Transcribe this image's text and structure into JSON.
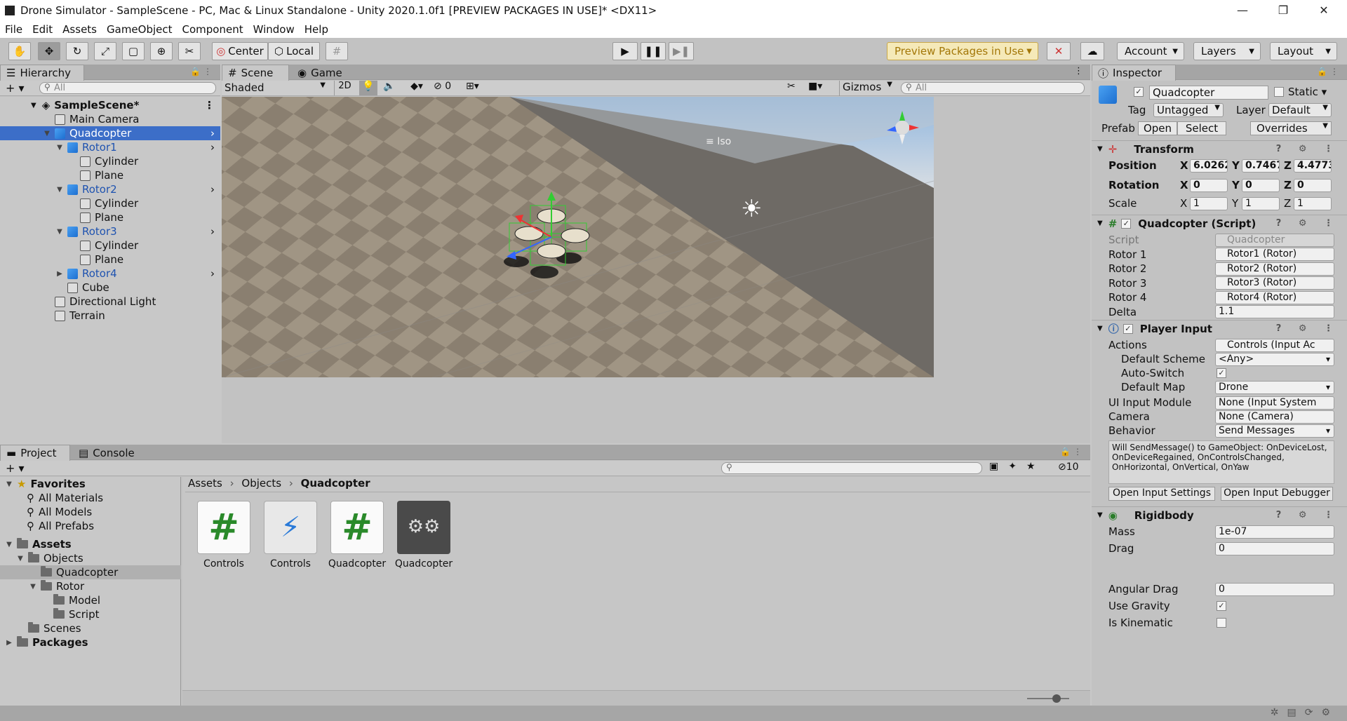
{
  "window": {
    "title": "Drone Simulator - SampleScene - PC, Mac & Linux Standalone - Unity 2020.1.0f1 [PREVIEW PACKAGES IN USE]* <DX11>"
  },
  "menu": [
    "File",
    "Edit",
    "Assets",
    "GameObject",
    "Component",
    "Window",
    "Help"
  ],
  "toolbar": {
    "center": "Center",
    "local": "Local",
    "preview": "Preview Packages in Use",
    "account": "Account",
    "layers": "Layers",
    "layout": "Layout"
  },
  "hierarchy": {
    "tab": "Hierarchy",
    "search_placeholder": "All",
    "scene": "SampleScene*",
    "items": [
      {
        "label": "Main Camera",
        "depth": 1,
        "kind": "gray"
      },
      {
        "label": "Quadcopter",
        "depth": 1,
        "kind": "blue",
        "open": true,
        "selected": true
      },
      {
        "label": "Rotor1",
        "depth": 2,
        "kind": "blue",
        "open": true
      },
      {
        "label": "Cylinder",
        "depth": 3,
        "kind": "gray"
      },
      {
        "label": "Plane",
        "depth": 3,
        "kind": "gray"
      },
      {
        "label": "Rotor2",
        "depth": 2,
        "kind": "blue",
        "open": true
      },
      {
        "label": "Cylinder",
        "depth": 3,
        "kind": "gray"
      },
      {
        "label": "Plane",
        "depth": 3,
        "kind": "gray"
      },
      {
        "label": "Rotor3",
        "depth": 2,
        "kind": "blue",
        "open": true
      },
      {
        "label": "Cylinder",
        "depth": 3,
        "kind": "gray"
      },
      {
        "label": "Plane",
        "depth": 3,
        "kind": "gray"
      },
      {
        "label": "Rotor4",
        "depth": 2,
        "kind": "blue",
        "open": false
      },
      {
        "label": "Cube",
        "depth": 2,
        "kind": "gray"
      },
      {
        "label": "Directional Light",
        "depth": 1,
        "kind": "gray"
      },
      {
        "label": "Terrain",
        "depth": 1,
        "kind": "gray"
      }
    ]
  },
  "scene": {
    "tab_scene": "Scene",
    "tab_game": "Game",
    "shading": "Shaded",
    "mode2d": "2D",
    "hidden_count": "0",
    "gizmos": "Gizmos",
    "search_placeholder": "All",
    "view": "Iso"
  },
  "inspector": {
    "tab": "Inspector",
    "name": "Quadcopter",
    "static": "Static",
    "tag_label": "Tag",
    "tag": "Untagged",
    "layer_label": "Layer",
    "layer": "Default",
    "prefab_label": "Prefab",
    "open": "Open",
    "select": "Select",
    "overrides": "Overrides",
    "transform": {
      "title": "Transform",
      "position": {
        "label": "Position",
        "x": "6.0262",
        "y": "0.7467",
        "z": "4.4773"
      },
      "rotation": {
        "label": "Rotation",
        "x": "0",
        "y": "0",
        "z": "0"
      },
      "scale": {
        "label": "Scale",
        "x": "1",
        "y": "1",
        "z": "1"
      }
    },
    "script": {
      "title": "Quadcopter (Script)",
      "fields": [
        {
          "label": "Script",
          "value": "Quadcopter"
        },
        {
          "label": "Rotor 1",
          "value": "Rotor1 (Rotor)"
        },
        {
          "label": "Rotor 2",
          "value": "Rotor2 (Rotor)"
        },
        {
          "label": "Rotor 3",
          "value": "Rotor3 (Rotor)"
        },
        {
          "label": "Rotor 4",
          "value": "Rotor4 (Rotor)"
        },
        {
          "label": "Delta",
          "value": "1.1"
        }
      ]
    },
    "player_input": {
      "title": "Player Input",
      "actions_label": "Actions",
      "actions": "Controls (Input Ac",
      "scheme_label": "Default Scheme",
      "scheme": "<Any>",
      "autoswitch_label": "Auto-Switch",
      "map_label": "Default Map",
      "map": "Drone",
      "ui_label": "UI Input Module",
      "ui": "None (Input System",
      "camera_label": "Camera",
      "camera": "None (Camera)",
      "behavior_label": "Behavior",
      "behavior": "Send Messages",
      "info": "Will SendMessage() to GameObject: OnDeviceLost, OnDeviceRegained, OnControlsChanged, OnHorizontal, OnVertical, OnYaw",
      "btn_settings": "Open Input Settings",
      "btn_debugger": "Open Input Debugger"
    },
    "rigidbody": {
      "title": "Rigidbody",
      "mass_label": "Mass",
      "mass": "1e-07",
      "drag_label": "Drag",
      "drag": "0",
      "adrag_label": "Angular Drag",
      "adrag": "0",
      "gravity_label": "Use Gravity",
      "kinematic_label": "Is Kinematic"
    }
  },
  "project": {
    "tab_project": "Project",
    "tab_console": "Console",
    "hidden_count": "10",
    "favorites": {
      "label": "Favorites",
      "items": [
        "All Materials",
        "All Models",
        "All Prefabs"
      ]
    },
    "assets_label": "Assets",
    "objects": "Objects",
    "quadcopter": "Quadcopter",
    "rotor": "Rotor",
    "model": "Model",
    "script": "Script",
    "scenes": "Scenes",
    "packages": "Packages",
    "breadcrumb": [
      "Assets",
      "Objects",
      "Quadcopter"
    ],
    "files": [
      {
        "label": "Controls",
        "kind": "cs"
      },
      {
        "label": "Controls",
        "kind": "input"
      },
      {
        "label": "Quadcopter",
        "kind": "cs"
      },
      {
        "label": "Quadcopter",
        "kind": "prefab"
      }
    ]
  }
}
